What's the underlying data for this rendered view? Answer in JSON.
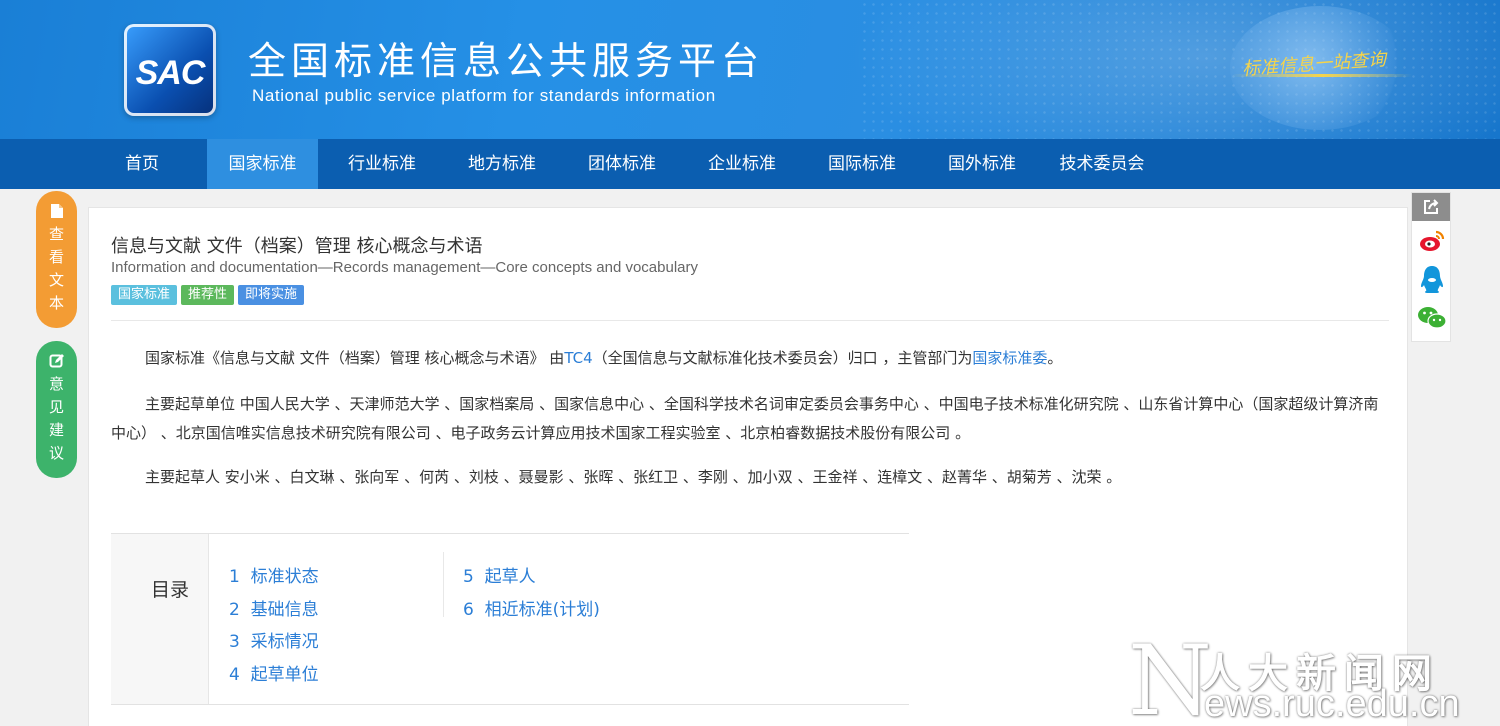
{
  "header": {
    "logo_text": "SAC",
    "title_cn": "全国标准信息公共服务平台",
    "title_en": "National public service platform  for standards information",
    "slogan": "标准信息一站查询"
  },
  "nav": {
    "items": [
      {
        "label": "首页"
      },
      {
        "label": "国家标准"
      },
      {
        "label": "行业标准"
      },
      {
        "label": "地方标准"
      },
      {
        "label": "团体标准"
      },
      {
        "label": "企业标准"
      },
      {
        "label": "国际标准"
      },
      {
        "label": "国外标准"
      },
      {
        "label": "技术委员会"
      }
    ],
    "active_index": 1
  },
  "standard": {
    "title_cn": "信息与文献 文件（档案）管理 核心概念与术语",
    "title_en": "Information and documentation—Records management—Core concepts and vocabulary",
    "tags": [
      {
        "label": "国家标准",
        "color": "#5bc0de"
      },
      {
        "label": "推荐性",
        "color": "#5cb85c"
      },
      {
        "label": "即将实施",
        "color": "#4a90e2"
      }
    ]
  },
  "description": {
    "p1_prefix": "国家标准《信息与文献 文件（档案）管理 核心概念与术语》 由",
    "p1_tc_link": "TC4",
    "p1_middle": "（全国信息与文献标准化技术委员会）归口 ，主管部门为",
    "p1_dept_link": "国家标准委",
    "p1_suffix": "。",
    "p2": "主要起草单位 中国人民大学 、天津师范大学 、国家档案局 、国家信息中心 、全国科学技术名词审定委员会事务中心 、中国电子技术标准化研究院 、山东省计算中心（国家超级计算济南中心） 、北京国信唯实信息技术研究院有限公司 、电子政务云计算应用技术国家工程实验室 、北京柏睿数据技术股份有限公司 。",
    "p3": "主要起草人 安小米 、白文琳 、张向军 、何芮 、刘枝 、聂曼影 、张晖 、张红卫 、李刚 、加小双 、王金祥 、连樟文 、赵菁华 、胡菊芳 、沈荣 。"
  },
  "toc": {
    "label": "目录",
    "items": [
      {
        "num": "1",
        "label": "标准状态"
      },
      {
        "num": "2",
        "label": "基础信息"
      },
      {
        "num": "3",
        "label": "采标情况"
      },
      {
        "num": "4",
        "label": "起草单位"
      },
      {
        "num": "5",
        "label": "起草人"
      },
      {
        "num": "6",
        "label": "相近标准(计划)"
      }
    ]
  },
  "float_buttons": {
    "view_text": {
      "chars": [
        "查",
        "看",
        "文",
        "本"
      ],
      "color": "#f39c34",
      "icon": "document-icon"
    },
    "feedback": {
      "chars": [
        "意",
        "见",
        "建",
        "议"
      ],
      "color": "#3db36b",
      "icon": "edit-icon"
    }
  },
  "share": {
    "icons": [
      "share-icon",
      "weibo-icon",
      "qq-icon",
      "wechat-icon"
    ]
  },
  "watermark": {
    "letter": "N",
    "cn": "人大新闻网",
    "en": "ews.ruc.edu.cn"
  }
}
